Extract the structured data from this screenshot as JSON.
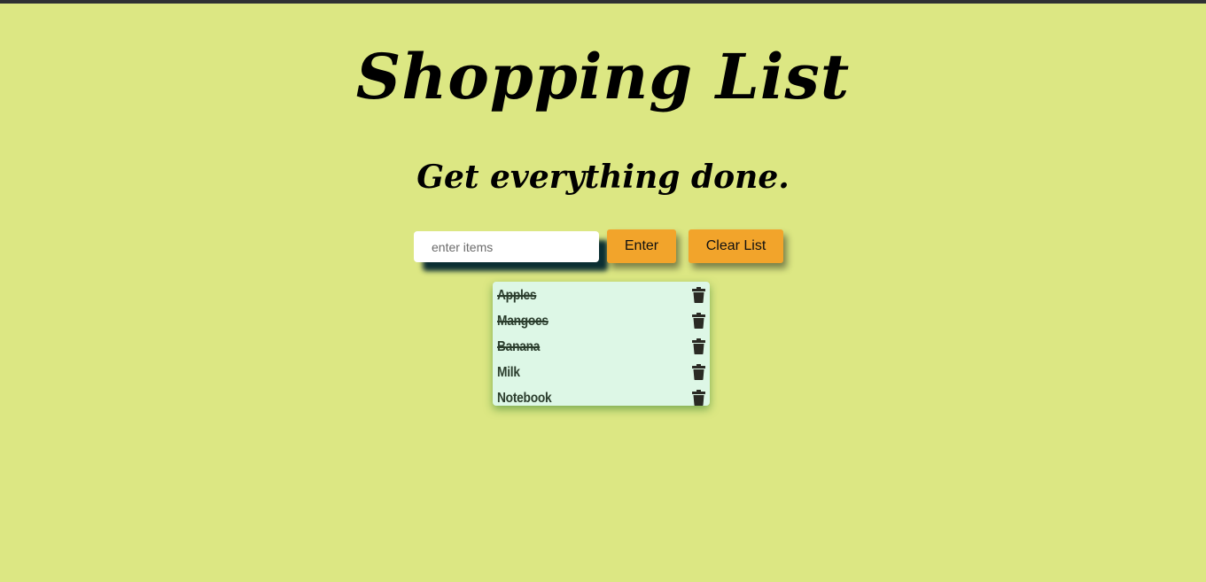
{
  "header": {
    "title": "Shopping List",
    "subtitle": "Get everything done."
  },
  "form": {
    "input_placeholder": "enter items",
    "input_value": "",
    "enter_label": "Enter",
    "clear_label": "Clear List"
  },
  "list": {
    "items": [
      {
        "label": "Apples",
        "done": true
      },
      {
        "label": "Mangoes",
        "done": true
      },
      {
        "label": "Banana",
        "done": true
      },
      {
        "label": "Milk",
        "done": false
      },
      {
        "label": "Notebook",
        "done": false
      }
    ],
    "delete_icon": "trash-icon"
  },
  "colors": {
    "background": "#dce783",
    "button": "#f2a42b",
    "list_background": "#ddf7e6",
    "item_text": "#2b3d2d"
  }
}
